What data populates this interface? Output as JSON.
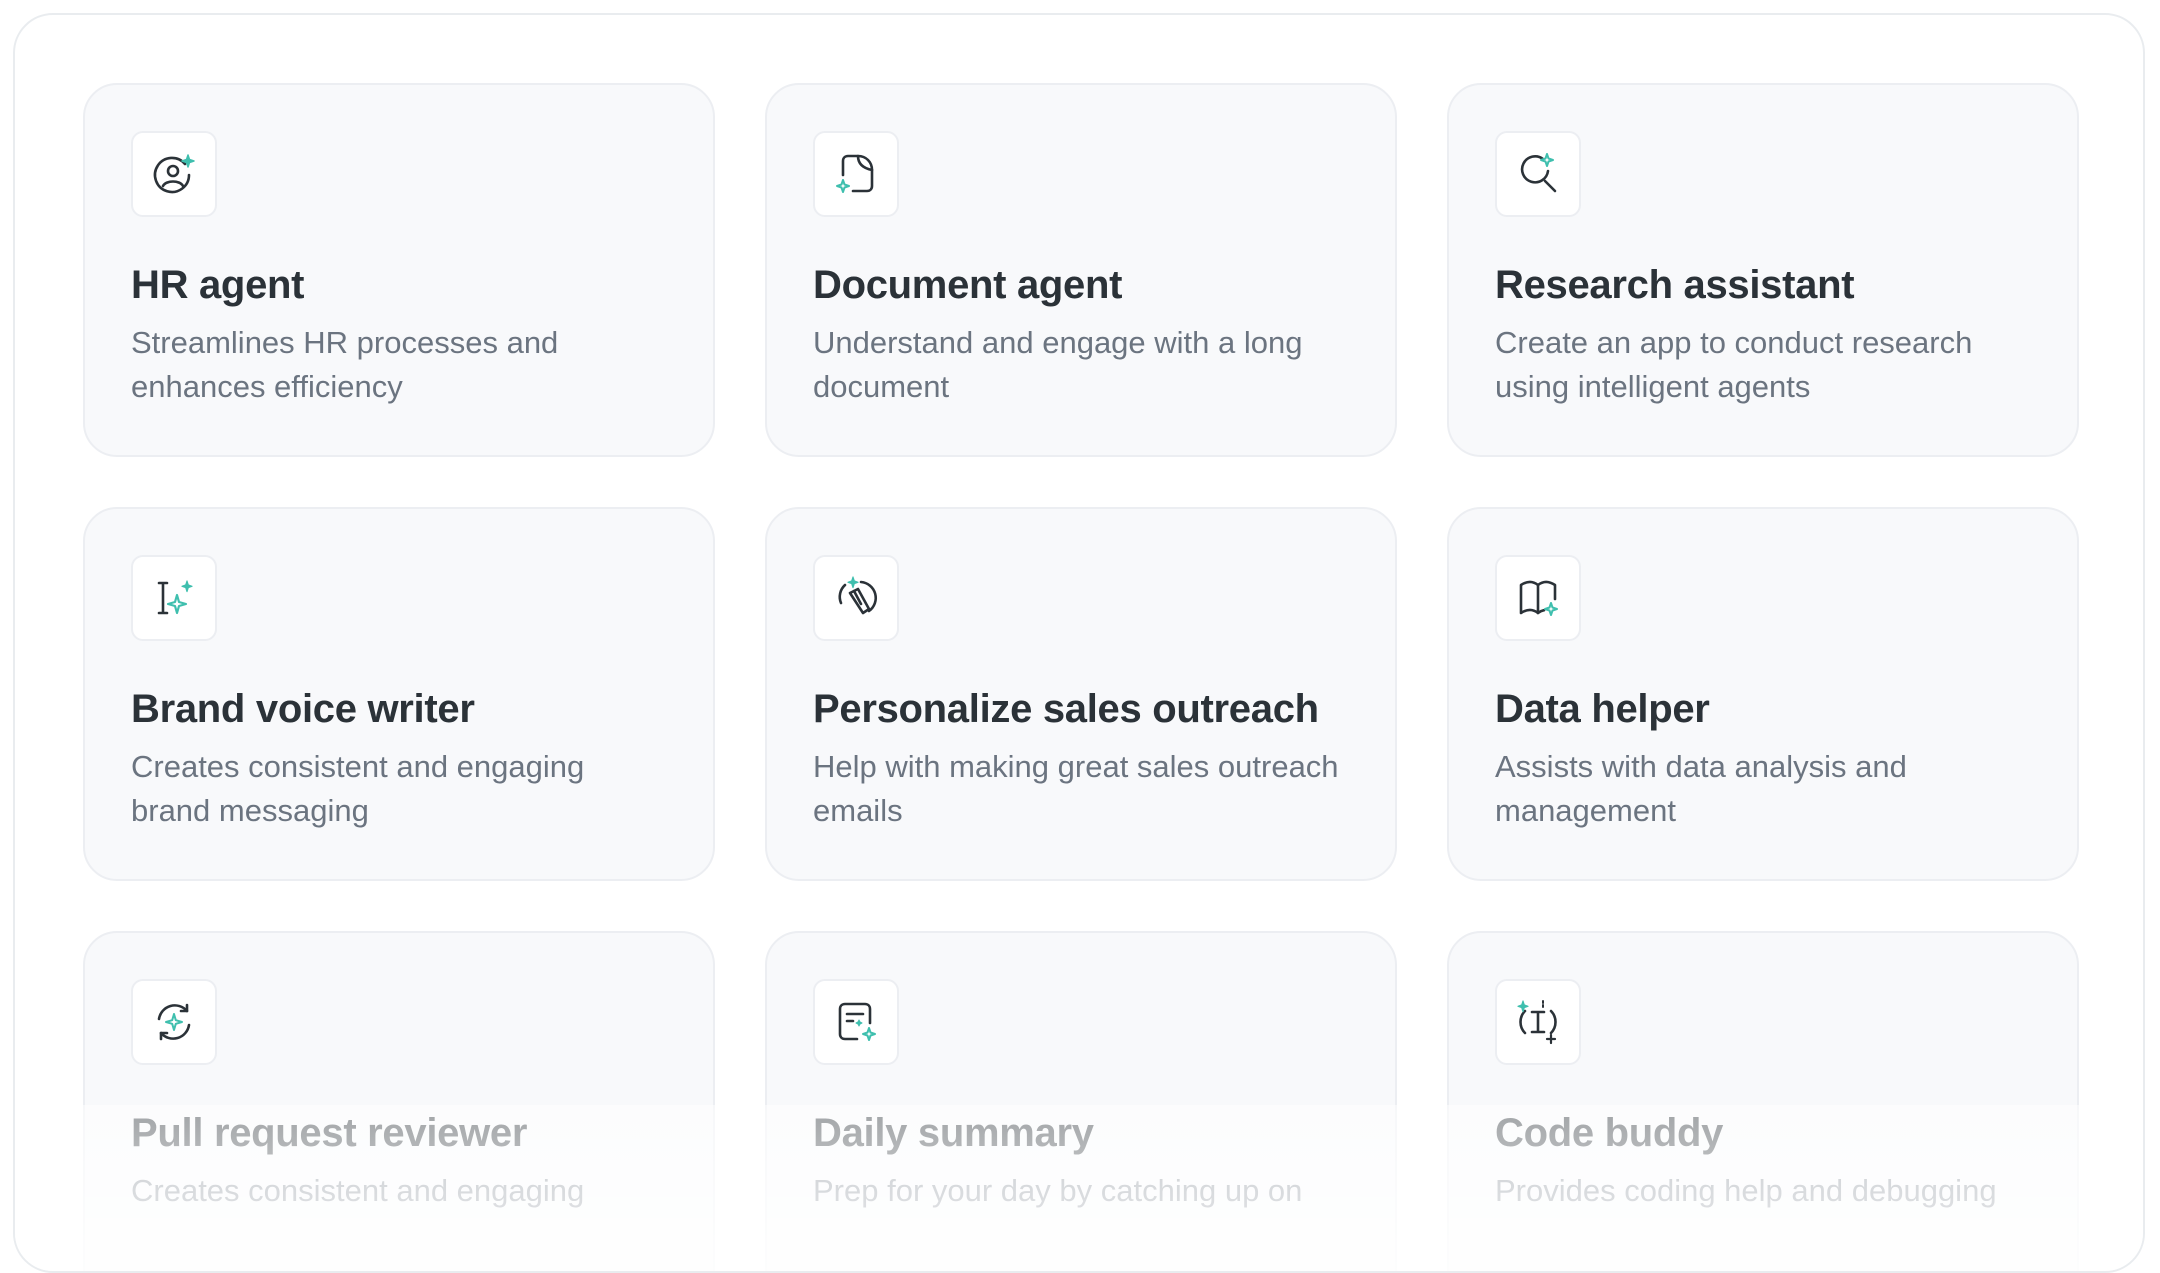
{
  "colors": {
    "accent": "#3fbfae",
    "icon_stroke": "#2b3238",
    "card_bg": "#f8f9fb",
    "card_border": "#eceef2",
    "title": "#2b3238",
    "description": "#6b7480"
  },
  "templates": [
    {
      "icon": "user-circle-sparkle-icon",
      "title": "HR agent",
      "description": "Streamlines HR processes and enhances efficiency"
    },
    {
      "icon": "document-sparkle-icon",
      "title": "Document agent",
      "description": "Understand and engage with a long document"
    },
    {
      "icon": "search-sparkle-icon",
      "title": "Research assistant",
      "description": "Create an app to conduct research using intelligent agents"
    },
    {
      "icon": "text-cursor-sparkle-icon",
      "title": "Brand voice writer",
      "description": "Creates consistent and engaging brand messaging"
    },
    {
      "icon": "pen-sparkle-icon",
      "title": "Personalize sales outreach",
      "description": "Help with making great sales outreach emails"
    },
    {
      "icon": "book-sparkle-icon",
      "title": "Data helper",
      "description": "Assists with data analysis and management"
    },
    {
      "icon": "refresh-sparkle-icon",
      "title": "Pull request reviewer",
      "description": "Creates consistent and engaging"
    },
    {
      "icon": "note-sparkle-icon",
      "title": "Daily summary",
      "description": " Prep for your day by catching up on"
    },
    {
      "icon": "code-sparkle-icon",
      "title": "Code buddy",
      "description": "Provides coding help and debugging"
    }
  ]
}
